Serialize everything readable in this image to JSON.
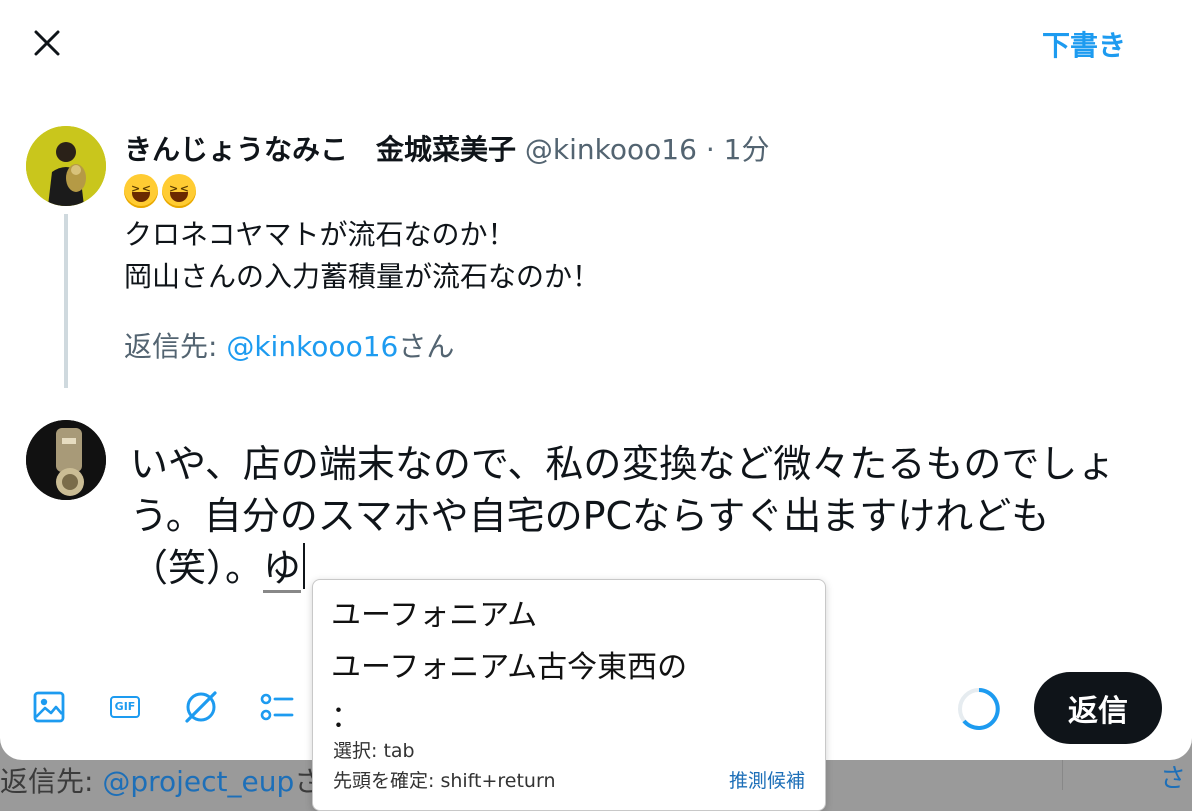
{
  "header": {
    "drafts_label": "下書き"
  },
  "original_tweet": {
    "display_name": "きんじょうなみこ　金城菜美子",
    "handle": "@kinkooo16",
    "separator": "·",
    "time": "1分",
    "emojis": [
      "grinning-squinting-face",
      "grinning-squinting-face"
    ],
    "body_lines": [
      "クロネコヤマトが流石なのか！",
      "岡山さんの入力蓄積量が流石なのか！"
    ],
    "reply_prefix": "返信先: ",
    "reply_mention": "@kinkooo16",
    "reply_suffix": "さん"
  },
  "compose": {
    "text": "いや、店の端末なので、私の変換など微々たるものでしょう。自分のスマホや自宅のPCならすぐ出ますけれども（笑）。",
    "composing": "ゆ"
  },
  "ime_popup": {
    "candidates": [
      "ユーフォニアム",
      "ユーフォニアム古今東西の",
      "："
    ],
    "hint_select": "選択: tab",
    "hint_confirm": "先頭を確定: shift+return",
    "predict_label": "推測候補"
  },
  "toolbar": {
    "icons": [
      "image-icon",
      "gif-icon",
      "grok-icon",
      "poll-icon"
    ],
    "gif_label": "GIF"
  },
  "reply_button_label": "返信",
  "underlay": {
    "prefix": "返信先: ",
    "handle": "@project_eup",
    "trail": "さ",
    "edge_glyph": "さ"
  },
  "colors": {
    "accent": "#1d9bf0",
    "text": "#0f1419",
    "muted": "#536471",
    "button_dark": "#0f1419"
  }
}
